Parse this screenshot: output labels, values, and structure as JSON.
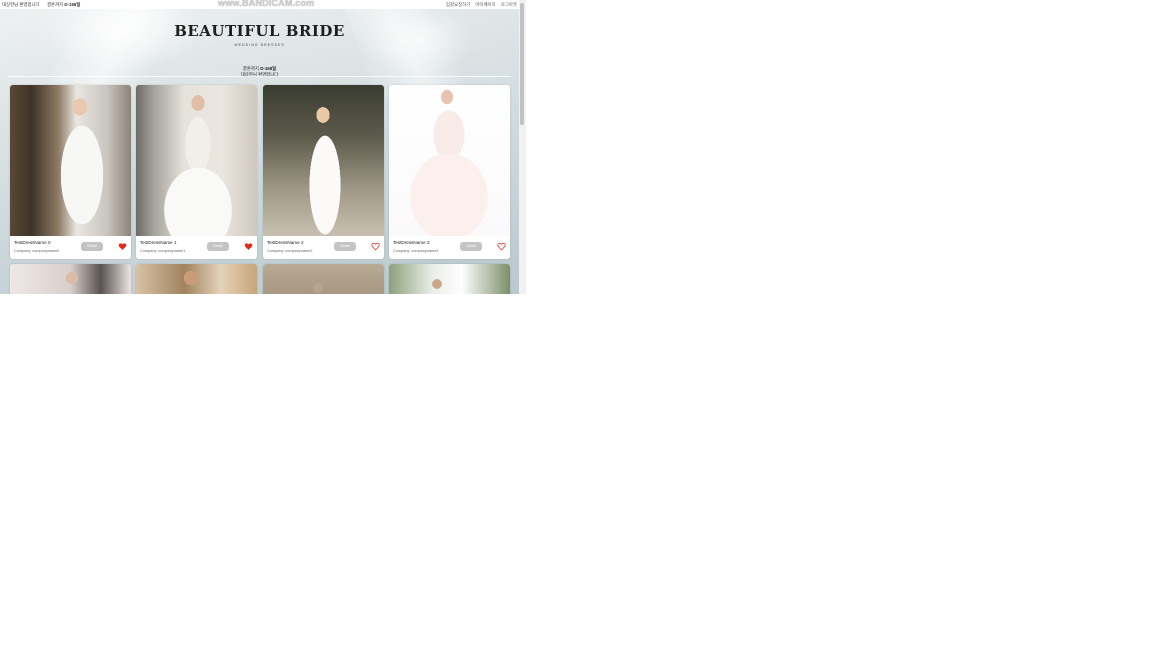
{
  "topbar": {
    "greeting": "대상현님 환영합니다",
    "dday_prefix": "결혼까지 ",
    "dday_value": "D-158일",
    "watermark": "www.BANDICAM.com",
    "links": [
      "입찰요청하기",
      "마이페이지",
      "로그아웃"
    ]
  },
  "hero": {
    "logo": "BEAUTIFUL BRIDE",
    "logo_sub": "WEDDING DRESSES",
    "notice_prefix": "결혼까지 ",
    "notice_dday": "D-158일",
    "notice_line2": "대상현님 환영합니다"
  },
  "cards": [
    {
      "name": "TestDressName 0",
      "company": "Company: companyname0",
      "detail": "Detail",
      "liked": true
    },
    {
      "name": "TestDressName 1",
      "company": "Company: companyname1",
      "detail": "Detail",
      "liked": true
    },
    {
      "name": "TestDressName 2",
      "company": "Company: companyname2",
      "detail": "Detail",
      "liked": false
    },
    {
      "name": "TestDressName 3",
      "company": "Company: companyname3",
      "detail": "Detail",
      "liked": false
    }
  ],
  "colors": {
    "heart_liked": "#e8261c",
    "heart_outline": "#e8261c",
    "detail_button": "#c4c4c4"
  }
}
